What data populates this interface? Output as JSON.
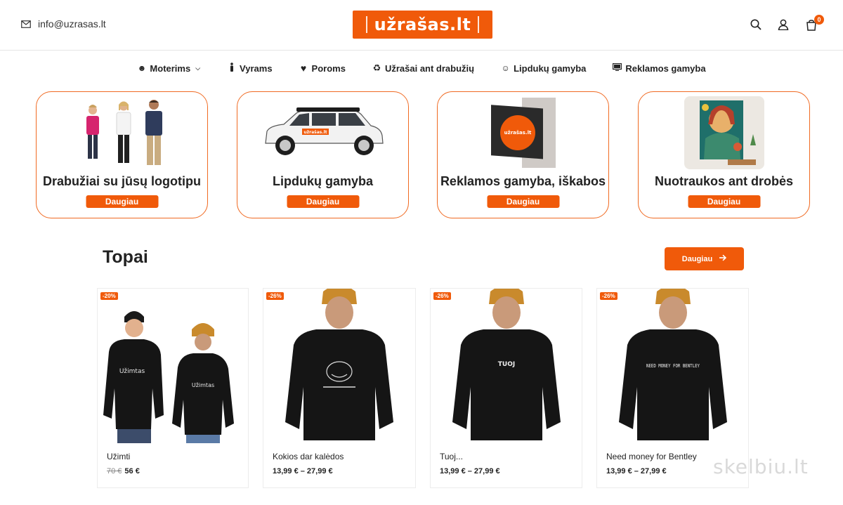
{
  "header": {
    "email": "info@uzrasas.lt",
    "logo_text": "užrašas.lt",
    "cart_count": "0"
  },
  "nav": [
    {
      "label": "Moterims",
      "icon": "smile-icon",
      "has_dropdown": true
    },
    {
      "label": "Vyrams",
      "icon": "person-icon"
    },
    {
      "label": "Poroms",
      "icon": "heart-icon"
    },
    {
      "label": "Užrašai ant drabužių",
      "icon": "recycle-icon"
    },
    {
      "label": "Lipdukų gamyba",
      "icon": "sticker-icon"
    },
    {
      "label": "Reklamos gamyba",
      "icon": "monitor-icon"
    }
  ],
  "categories": [
    {
      "title": "Drabužiai su jūsų logotipu",
      "button": "Daugiau"
    },
    {
      "title": "Lipdukų gamyba",
      "button": "Daugiau",
      "car_label": "užrašas.lt"
    },
    {
      "title": "Reklamos gamyba, iškabos",
      "button": "Daugiau",
      "sign_label": "užrašas.lt"
    },
    {
      "title": "Nuotraukos ant drobės",
      "button": "Daugiau"
    }
  ],
  "section": {
    "title": "Topai",
    "more_button": "Daugiau"
  },
  "products": [
    {
      "badge": "-20%",
      "name": "Užimti",
      "old_price": "70 €",
      "price": "56 €",
      "print": "Užimtas"
    },
    {
      "badge": "-26%",
      "name": "Kokios dar kalėdos",
      "price": "13,99 € – 27,99 €"
    },
    {
      "badge": "-26%",
      "name": "Tuoj...",
      "price": "13,99 € – 27,99 €",
      "print": "TUOJ"
    },
    {
      "badge": "-26%",
      "name": "Need money for Bentley",
      "price": "13,99 € – 27,99 €",
      "print": "NEED MONEY FOR BENTLEY"
    }
  ],
  "watermark": "skelbiu.lt",
  "colors": {
    "accent": "#f05a0a",
    "border": "#f06a22"
  }
}
